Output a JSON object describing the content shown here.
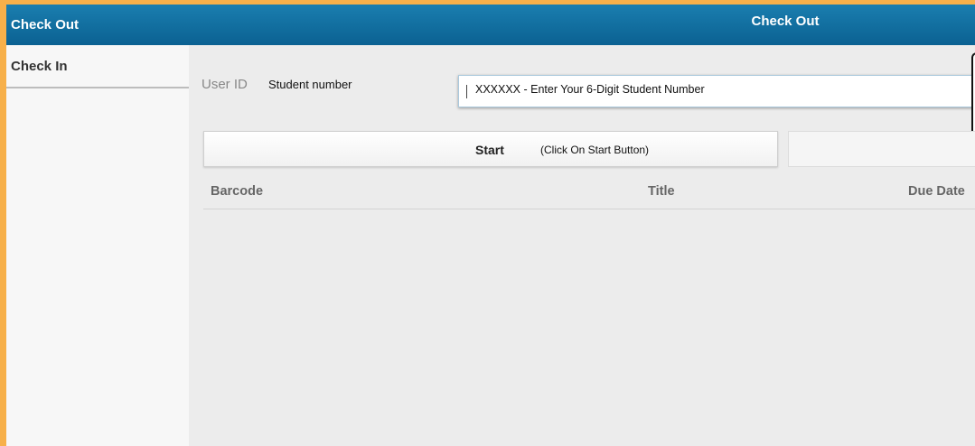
{
  "sidebar": {
    "items": [
      {
        "label": "Check Out",
        "active": true
      },
      {
        "label": "Check In",
        "active": false
      }
    ]
  },
  "header": {
    "title": "Check Out"
  },
  "form": {
    "user_id_label": "User ID",
    "user_id_note": "Student number",
    "user_id_input_text": "XXXXXX - Enter Your 6-Digit Student Number"
  },
  "buttons": {
    "start_label": "Start",
    "start_hint": "(Click On Start Button)"
  },
  "table": {
    "columns": [
      "Barcode",
      "Title",
      "Due Date"
    ]
  },
  "colors": {
    "accent": "#0f6e9f",
    "frame": "#f7b04a",
    "background": "#ececec"
  }
}
